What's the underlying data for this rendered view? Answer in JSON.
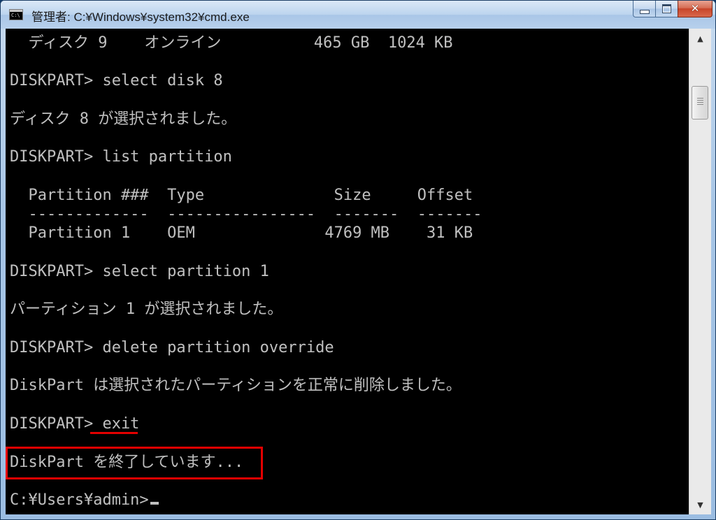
{
  "window": {
    "title": "管理者: C:¥Windows¥system32¥cmd.exe",
    "icon_label": "C:\\",
    "controls": {
      "minimize_icon": "minimize-icon",
      "maximize_icon": "maximize-icon",
      "close_symbol": "✕"
    }
  },
  "console": {
    "lines": [
      "  ディスク 9    オンライン          465 GB  1024 KB",
      "DISKPART> select disk 8",
      "ディスク 8 が選択されました。",
      "DISKPART> list partition",
      "  Partition ###  Type              Size     Offset",
      "  -------------  ----------------  -------  -------",
      "  Partition 1    OEM              4769 MB    31 KB",
      "DISKPART> select partition 1",
      "パーティション 1 が選択されました。",
      "DISKPART> delete partition override",
      "DiskPart は選択されたパーティションを正常に削除しました。",
      "DISKPART> exit",
      "DiskPart を終了しています...",
      "C:¥Users¥admin>"
    ]
  },
  "annotations": {
    "underline_color": "#e30000",
    "box_color": "#e30000"
  },
  "scrollbar": {
    "up_arrow": "▲",
    "down_arrow": "▼"
  }
}
